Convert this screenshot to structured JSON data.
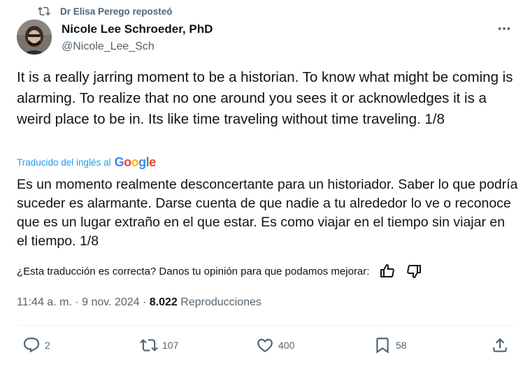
{
  "repost": {
    "text": "Dr Elisa Perego reposteó",
    "icon": "repost-icon"
  },
  "author": {
    "name": "Nicole Lee Schroeder, PhD",
    "handle": "@Nicole_Lee_Sch"
  },
  "tweet": {
    "text": "It is a really jarring moment to be a historian. To know what might be coming is alarming. To realize that no one around you sees it or acknowledges it is a weird place to be in. Its like time traveling without time traveling. 1/8",
    "translated_label": "Traducido del inglés al",
    "translator": "Google",
    "translation": "Es un momento realmente desconcertante para un historiador. Saber lo que podría suceder es alarmante. Darse cuenta de que nadie a tu alrededor lo ve o reconoce que es un lugar extraño en el que estar. Es como viajar en el tiempo sin viajar en el tiempo. 1/8"
  },
  "feedback": {
    "question": "¿Esta traducción es correcta? Danos tu opinión para que podamos mejorar:"
  },
  "meta": {
    "time": "11:44 a. m.",
    "separator": "·",
    "date": "9 nov. 2024",
    "views_count": "8.022",
    "views_label": "Reproducciones"
  },
  "actions": {
    "replies": "2",
    "reposts": "107",
    "likes": "400",
    "bookmarks": "58"
  },
  "colors": {
    "text": "#0f1419",
    "secondary": "#536471",
    "link": "#1d9bf0",
    "divider": "#eff3f4"
  }
}
